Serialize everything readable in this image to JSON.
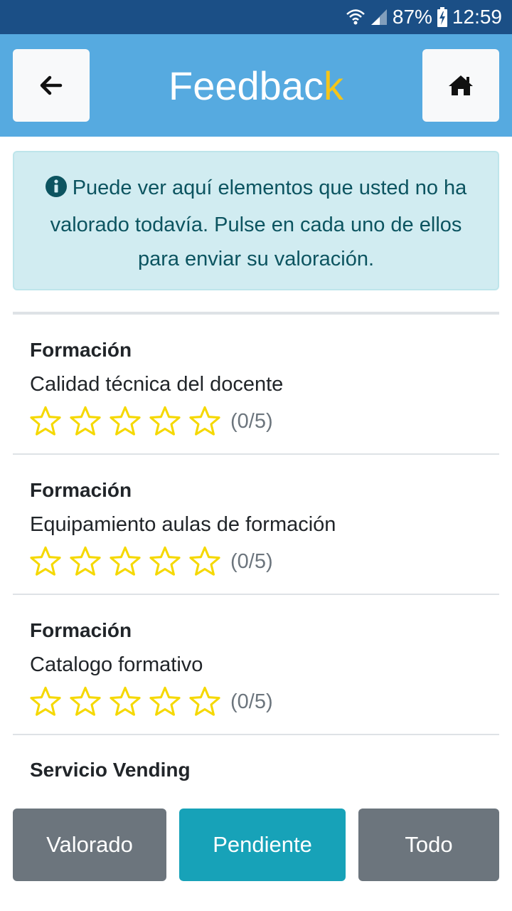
{
  "status_bar": {
    "battery": "87%",
    "time": "12:59",
    "icons": [
      "wifi-icon",
      "signal-icon",
      "battery-charging-icon"
    ]
  },
  "header": {
    "title_main": "Feedbac",
    "title_accent": "k",
    "back_icon": "arrow-left-icon",
    "home_icon": "home-icon"
  },
  "alert": {
    "icon": "info-icon",
    "text": "Puede ver aquí elementos que usted no ha valorado todavía. Pulse en cada uno de ellos para enviar su valoración."
  },
  "items": [
    {
      "category": "Formación",
      "name": "Calidad técnica del docente",
      "rating": 0,
      "max": 5,
      "count": "(0/5)"
    },
    {
      "category": "Formación",
      "name": "Equipamiento aulas de formación",
      "rating": 0,
      "max": 5,
      "count": "(0/5)"
    },
    {
      "category": "Formación",
      "name": "Catalogo formativo",
      "rating": 0,
      "max": 5,
      "count": "(0/5)"
    },
    {
      "category": "Servicio Vending"
    }
  ],
  "tabs": {
    "valorado": "Valorado",
    "pendiente": "Pendiente",
    "todo": "Todo",
    "active": "Pendiente"
  },
  "colors": {
    "header": "#56aae0",
    "status_bar": "#1b4f86",
    "accent": "#f5c518",
    "active_tab": "#17a2b8",
    "inactive_tab": "#6c757d",
    "star": "#f5d800"
  }
}
